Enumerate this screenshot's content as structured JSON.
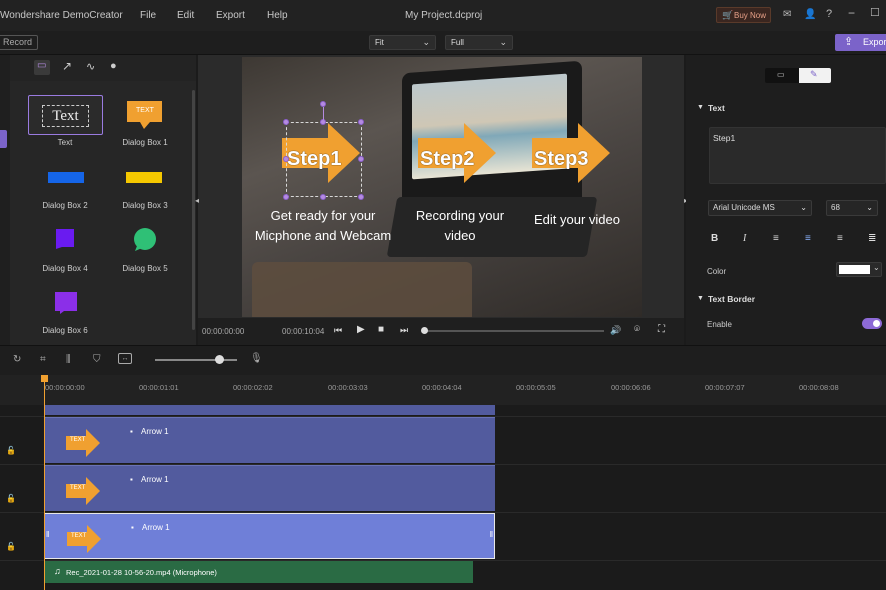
{
  "titlebar": {
    "app_name": "Wondershare DemoCreator",
    "menu": [
      "File",
      "Edit",
      "Export",
      "Help"
    ],
    "project": "My Project.dcproj",
    "buy_now": "Buy Now"
  },
  "toolbar": {
    "record": "Record",
    "fit": "Fit",
    "full": "Full",
    "export": "Expor"
  },
  "annotation_panel": {
    "items": [
      {
        "label": "Text",
        "thumb": "Text"
      },
      {
        "label": "Dialog Box 1",
        "thumb": "TEXT"
      },
      {
        "label": "Dialog Box 2"
      },
      {
        "label": "Dialog Box 3"
      },
      {
        "label": "Dialog Box 4"
      },
      {
        "label": "Dialog Box 5"
      },
      {
        "label": "Dialog Box 6"
      }
    ]
  },
  "preview": {
    "steps": [
      "Step1",
      "Step2",
      "Step3"
    ],
    "captions": [
      "Get ready for your Micphone and Webcam",
      "Recording your video",
      "Edit your video"
    ],
    "time_current": "00:00:00:00",
    "time_total": "00:00:10:04"
  },
  "properties": {
    "section_text": "Text",
    "text_value": "Step1",
    "font": "Arial Unicode MS",
    "size": "68",
    "color_label": "Color",
    "section_border": "Text Border",
    "enable_label": "Enable"
  },
  "timeline": {
    "ruler": [
      "00:00:00:00",
      "00:00:01:01",
      "00:00:02:02",
      "00:00:03:03",
      "00:00:04:04",
      "00:00:05:05",
      "00:00:06:06",
      "00:00:07:07",
      "00:00:08:08"
    ],
    "clips": [
      {
        "name": "Arrow 1",
        "thumb": "TEXT"
      },
      {
        "name": "Arrow 1",
        "thumb": "TEXT"
      },
      {
        "name": "Arrow 1",
        "thumb": "TEXT"
      }
    ],
    "audio": "Rec_2021-01-28 10-56-20.mp4 (Microphone)"
  },
  "colors": {
    "accent": "#7b63c9",
    "arrow": "#f0a030",
    "clip": "#525b9e",
    "clip_selected": "#6f7fd8",
    "audio": "#2a6b44"
  }
}
